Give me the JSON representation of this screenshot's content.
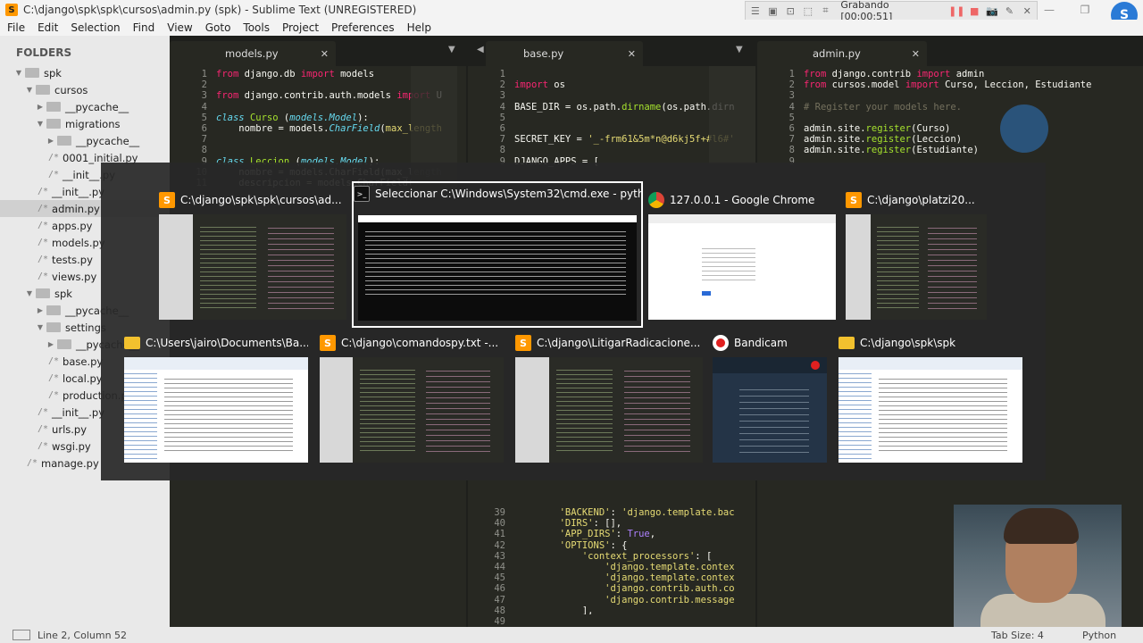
{
  "window": {
    "title": "C:\\django\\spk\\spk\\cursos\\admin.py (spk) - Sublime Text (UNREGISTERED)",
    "app_icon": "sublime-icon"
  },
  "recorder": {
    "status": "Grabando [00:00:51]",
    "pause_color": "#ee5555"
  },
  "menu": [
    "File",
    "Edit",
    "Selection",
    "Find",
    "View",
    "Goto",
    "Tools",
    "Project",
    "Preferences",
    "Help"
  ],
  "avatar_letter": "S",
  "sidebar": {
    "title": "FOLDERS",
    "items": [
      {
        "label": "spk",
        "type": "folder",
        "open": true,
        "indent": 0
      },
      {
        "label": "cursos",
        "type": "folder",
        "open": true,
        "indent": 1
      },
      {
        "label": "__pycache__",
        "type": "folder",
        "open": false,
        "indent": 2
      },
      {
        "label": "migrations",
        "type": "folder",
        "open": true,
        "indent": 2
      },
      {
        "label": "__pycache__",
        "type": "folder",
        "open": false,
        "indent": 3
      },
      {
        "label": "0001_initial.py",
        "type": "file",
        "indent": 3
      },
      {
        "label": "__init__.py",
        "type": "file",
        "indent": 3
      },
      {
        "label": "__init__.py",
        "type": "file",
        "indent": 2
      },
      {
        "label": "admin.py",
        "type": "file",
        "indent": 2,
        "selected": true
      },
      {
        "label": "apps.py",
        "type": "file",
        "indent": 2
      },
      {
        "label": "models.py",
        "type": "file",
        "indent": 2
      },
      {
        "label": "tests.py",
        "type": "file",
        "indent": 2
      },
      {
        "label": "views.py",
        "type": "file",
        "indent": 2
      },
      {
        "label": "spk",
        "type": "folder",
        "open": true,
        "indent": 1
      },
      {
        "label": "__pycache__",
        "type": "folder",
        "open": false,
        "indent": 2
      },
      {
        "label": "settings",
        "type": "folder",
        "open": true,
        "indent": 2
      },
      {
        "label": "__pycache__",
        "type": "folder",
        "open": false,
        "indent": 3
      },
      {
        "label": "base.py",
        "type": "file",
        "indent": 3
      },
      {
        "label": "local.py",
        "type": "file",
        "indent": 3
      },
      {
        "label": "production.py",
        "type": "file",
        "indent": 3
      },
      {
        "label": "__init__.py",
        "type": "file",
        "indent": 2
      },
      {
        "label": "urls.py",
        "type": "file",
        "indent": 2
      },
      {
        "label": "wsgi.py",
        "type": "file",
        "indent": 2
      },
      {
        "label": "manage.py",
        "type": "file",
        "indent": 1
      }
    ]
  },
  "panes": [
    {
      "tab": "models.py",
      "lines": [
        {
          "n": "1",
          "html": "<span class='kw'>from</span> django.db <span class='kw'>import</span> models"
        },
        {
          "n": "2",
          "html": ""
        },
        {
          "n": "3",
          "html": "<span class='kw'>from</span> django.contrib.auth.models <span class='kw'>import</span> U"
        },
        {
          "n": "4",
          "html": ""
        },
        {
          "n": "5",
          "html": "<span class='cls'>class</span> <span class='fn'>Curso</span> (<span class='cls'>models.Model</span>):"
        },
        {
          "n": "6",
          "html": "    nombre = models.<span class='cls'>CharField</span>(<span class='str'>max_length</span>"
        },
        {
          "n": "7",
          "html": ""
        },
        {
          "n": "8",
          "html": ""
        },
        {
          "n": "9",
          "html": "<span class='cls'>class</span> <span class='fn'>Leccion</span> (<span class='cls'>models.Model</span>):"
        },
        {
          "n": "10",
          "html": "    nombre = models.CharField(max_length"
        },
        {
          "n": "11",
          "html": "    descripcion = models.CharField("
        }
      ]
    },
    {
      "tab": "base.py",
      "lines_top": [
        {
          "n": "1",
          "html": ""
        },
        {
          "n": "2",
          "html": "<span class='kw'>import</span> os"
        },
        {
          "n": "3",
          "html": ""
        },
        {
          "n": "4",
          "html": "BASE_DIR = os.path.<span class='fn'>dirname</span>(os.path.dirn"
        },
        {
          "n": "5",
          "html": ""
        },
        {
          "n": "6",
          "html": ""
        },
        {
          "n": "7",
          "html": "SECRET_KEY = <span class='str'>'_-frm61&amp;5m*n@d6kj5f+#l6#'</span>"
        },
        {
          "n": "8",
          "html": ""
        },
        {
          "n": "9",
          "html": "DJANGO_APPS = ["
        }
      ],
      "lines_bottom": [
        {
          "n": "39",
          "html": "        <span class='str'>'BACKEND'</span>: <span class='str'>'django.template.bac</span>"
        },
        {
          "n": "40",
          "html": "        <span class='str'>'DIRS'</span>: [],"
        },
        {
          "n": "41",
          "html": "        <span class='str'>'APP_DIRS'</span>: <span class='bl'>True</span>,"
        },
        {
          "n": "42",
          "html": "        <span class='str'>'OPTIONS'</span>: {"
        },
        {
          "n": "43",
          "html": "            <span class='str'>'context_processors'</span>: ["
        },
        {
          "n": "44",
          "html": "                <span class='str'>'django.template.contex</span>"
        },
        {
          "n": "45",
          "html": "                <span class='str'>'django.template.contex</span>"
        },
        {
          "n": "46",
          "html": "                <span class='str'>'django.contrib.auth.co</span>"
        },
        {
          "n": "47",
          "html": "                <span class='str'>'django.contrib.message</span>"
        },
        {
          "n": "48",
          "html": "            ],"
        },
        {
          "n": "49",
          "html": "        },"
        },
        {
          "n": "50",
          "html": "    },"
        }
      ]
    },
    {
      "tab": "admin.py",
      "lines": [
        {
          "n": "1",
          "html": "<span class='kw'>from</span> django.contrib <span class='kw'>import</span> admin"
        },
        {
          "n": "2",
          "html": "<span class='kw'>from</span> cursos.model <span class='kw'>import</span> Curso, Leccion, Estudiante"
        },
        {
          "n": "3",
          "html": ""
        },
        {
          "n": "4",
          "html": "<span class='cm'># Register your models here.</span>"
        },
        {
          "n": "5",
          "html": ""
        },
        {
          "n": "6",
          "html": "admin.site.<span class='fn'>register</span>(Curso)"
        },
        {
          "n": "7",
          "html": "admin.site.<span class='fn'>register</span>(Leccion)"
        },
        {
          "n": "8",
          "html": "admin.site.<span class='fn'>register</span>(Estudiante)"
        },
        {
          "n": "9",
          "html": ""
        }
      ]
    }
  ],
  "switcher": {
    "row1": [
      {
        "title": "C:\\django\\spk\\spk\\cursos\\ad...",
        "icon": "sublime-icon",
        "icon_color": "#ff9800",
        "thumb": "dark-editor"
      },
      {
        "title": "Seleccionar C:\\Windows\\System32\\cmd.exe - pyth...",
        "icon": "cmd-icon",
        "icon_color": "#111111",
        "thumb": "cmd",
        "selected": true
      },
      {
        "title": "127.0.0.1 - Google Chrome",
        "icon": "chrome-icon",
        "icon_color": "#ffffff",
        "thumb": "browser"
      },
      {
        "title": "C:\\django\\platzi20...",
        "icon": "sublime-icon",
        "icon_color": "#ff9800",
        "thumb": "dark-editor"
      }
    ],
    "row2": [
      {
        "title": "C:\\Users\\jairo\\Documents\\Ba...",
        "icon": "folder-icon",
        "icon_color": "#f2c12e",
        "thumb": "explorer"
      },
      {
        "title": "C:\\django\\comandospy.txt -...",
        "icon": "sublime-icon",
        "icon_color": "#ff9800",
        "thumb": "dark-editor"
      },
      {
        "title": "C:\\django\\LitigarRadicacione...",
        "icon": "sublime-icon",
        "icon_color": "#ff9800",
        "thumb": "dark-editor"
      },
      {
        "title": "Bandicam",
        "icon": "record-icon",
        "icon_color": "#e02020",
        "thumb": "bandicam"
      },
      {
        "title": "C:\\django\\spk\\spk",
        "icon": "folder-icon",
        "icon_color": "#f2c12e",
        "thumb": "explorer"
      }
    ]
  },
  "statusbar": {
    "position": "Line 2, Column 52",
    "tab_size": "Tab Size: 4",
    "syntax": "Python"
  }
}
